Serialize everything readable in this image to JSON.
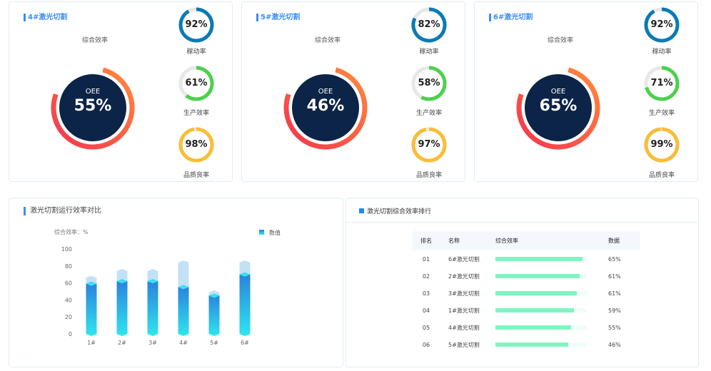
{
  "machines": [
    {
      "title": "4#激光切割",
      "subtitle": "综合效率",
      "oee_label": "OEE",
      "oee": "55%",
      "gauges": [
        {
          "label": "稼动率",
          "value": 92,
          "text": "92%",
          "color": "#0a7bb5"
        },
        {
          "label": "生产效率",
          "value": 61,
          "text": "61%",
          "color": "#4cd14c"
        },
        {
          "label": "品质良率",
          "value": 98,
          "text": "98%",
          "color": "#fbbd36"
        }
      ]
    },
    {
      "title": "5#激光切割",
      "subtitle": "综合效率",
      "oee_label": "OEE",
      "oee": "46%",
      "gauges": [
        {
          "label": "稼动率",
          "value": 82,
          "text": "82%",
          "color": "#0a7bb5"
        },
        {
          "label": "生产效率",
          "value": 58,
          "text": "58%",
          "color": "#4cd14c"
        },
        {
          "label": "品质良率",
          "value": 97,
          "text": "97%",
          "color": "#fbbd36"
        }
      ]
    },
    {
      "title": "6#激光切割",
      "subtitle": "综合效率",
      "oee_label": "OEE",
      "oee": "65%",
      "gauges": [
        {
          "label": "稼动率",
          "value": 92,
          "text": "92%",
          "color": "#0a7bb5"
        },
        {
          "label": "生产效率",
          "value": 71,
          "text": "71%",
          "color": "#4cd14c"
        },
        {
          "label": "品质良率",
          "value": 99,
          "text": "99%",
          "color": "#fbbd36"
        }
      ]
    }
  ],
  "bar_panel": {
    "title": "激光切割运行效率对比"
  },
  "chart_data": {
    "type": "bar",
    "title": "激光切割运行效率对比",
    "ylabel": "综合效率：%",
    "legend": "数值",
    "legend_position": "top-right",
    "categories": [
      "1#",
      "2#",
      "3#",
      "4#",
      "5#",
      "6#"
    ],
    "values": [
      59,
      62,
      62,
      55,
      45,
      70
    ],
    "background_values": [
      66,
      74,
      74,
      84,
      49,
      84
    ],
    "ylim": [
      0,
      100
    ],
    "yticks": [
      0,
      20,
      40,
      60,
      80,
      100
    ]
  },
  "ranking": {
    "title": "激光切割综合效率排行",
    "headers": [
      "排名",
      "名称",
      "综合效率",
      "数据"
    ],
    "rows": [
      {
        "rank": "01",
        "name": "6#激光切割",
        "value": 65,
        "text": "65%"
      },
      {
        "rank": "02",
        "name": "2#激光切割",
        "value": 61,
        "text": "61%"
      },
      {
        "rank": "03",
        "name": "3#激光切割",
        "value": 61,
        "text": "61%"
      },
      {
        "rank": "04",
        "name": "1#激光切割",
        "value": 59,
        "text": "59%"
      },
      {
        "rank": "05",
        "name": "4#激光切割",
        "value": 55,
        "text": "55%"
      },
      {
        "rank": "06",
        "name": "5#激光切割",
        "value": 46,
        "text": "46%"
      }
    ]
  }
}
